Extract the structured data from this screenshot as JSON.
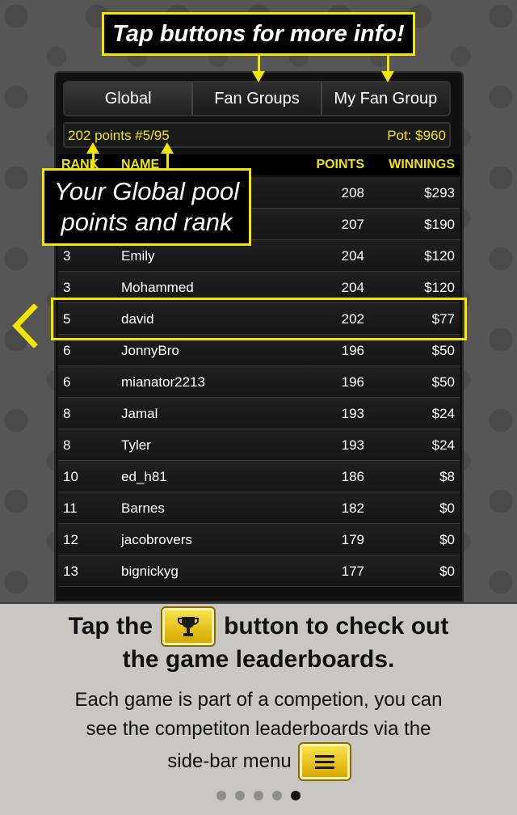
{
  "callouts": {
    "top": "Tap buttons for more info!",
    "pool_line1": "Your Global pool",
    "pool_line2": "points and rank"
  },
  "tabs": [
    {
      "label": "Global",
      "active": true
    },
    {
      "label": "Fan Groups",
      "active": false
    },
    {
      "label": "My Fan Group",
      "active": false
    }
  ],
  "infobar": {
    "points": "202 points  #5/95",
    "pot": "Pot: $960"
  },
  "table": {
    "headers": {
      "rank": "RANK",
      "name": "NAME",
      "points": "POINTS",
      "winnings": "WINNINGS"
    },
    "rows": [
      {
        "rank": "",
        "name": "",
        "points": "208",
        "winnings": "$293"
      },
      {
        "rank": "",
        "name": "",
        "points": "207",
        "winnings": "$190"
      },
      {
        "rank": "3",
        "name": "Emily",
        "points": "204",
        "winnings": "$120"
      },
      {
        "rank": "3",
        "name": "Mohammed",
        "points": "204",
        "winnings": "$120"
      },
      {
        "rank": "5",
        "name": "david",
        "points": "202",
        "winnings": "$77"
      },
      {
        "rank": "6",
        "name": "JonnyBro",
        "points": "196",
        "winnings": "$50"
      },
      {
        "rank": "6",
        "name": "mianator2213",
        "points": "196",
        "winnings": "$50"
      },
      {
        "rank": "8",
        "name": "Jamal",
        "points": "193",
        "winnings": "$24"
      },
      {
        "rank": "8",
        "name": "Tyler",
        "points": "193",
        "winnings": "$24"
      },
      {
        "rank": "10",
        "name": "ed_h81",
        "points": "186",
        "winnings": "$8"
      },
      {
        "rank": "11",
        "name": "Barnes",
        "points": "182",
        "winnings": "$0"
      },
      {
        "rank": "12",
        "name": "jacobrovers",
        "points": "179",
        "winnings": "$0"
      },
      {
        "rank": "13",
        "name": "bignickyg",
        "points": "177",
        "winnings": "$0"
      }
    ]
  },
  "bottom": {
    "headline_pre": "Tap the",
    "headline_post": "button to check out",
    "headline_line2": "the game leaderboards.",
    "sub_line1": "Each game is part of a competion, you can",
    "sub_line2": "see the competiton leaderboards via the",
    "sub_line3": "side-bar menu"
  },
  "icons": {
    "trophy": "trophy-icon",
    "menu": "menu-icon",
    "chevron": "chevron-left-icon"
  },
  "colors": {
    "accent": "#f2e600",
    "button_gold": "#e8c51a"
  },
  "pagination": {
    "count": 5,
    "active_index": 4
  }
}
